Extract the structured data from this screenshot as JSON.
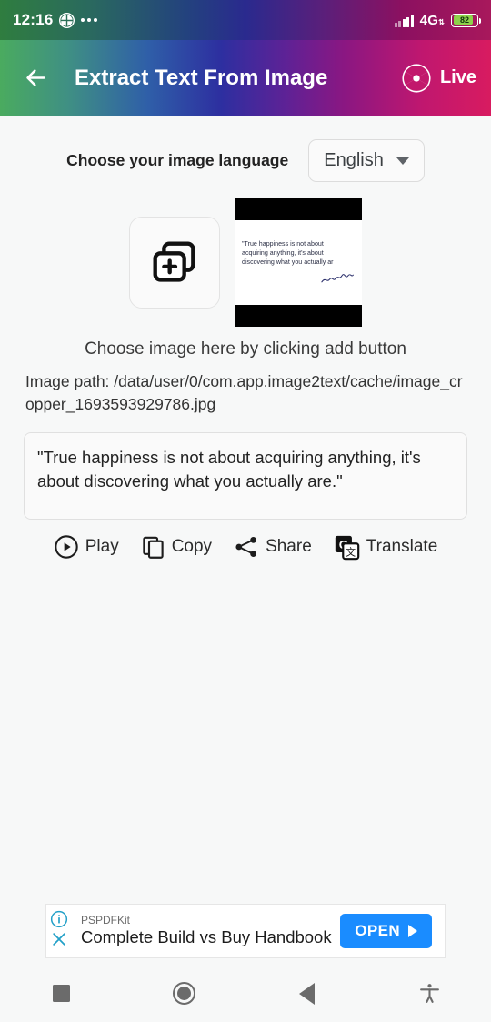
{
  "status_bar": {
    "time": "12:16",
    "network": "4G",
    "battery_level": "82",
    "battery_percent": 82,
    "icons": [
      "clover-icon",
      "more-dots-icon",
      "signal-icon",
      "network-4g-icon",
      "battery-icon"
    ]
  },
  "app_bar": {
    "title": "Extract Text From Image",
    "back_icon": "arrow-left-icon",
    "live_label": "Live",
    "live_icon": "camera-shutter-icon"
  },
  "language": {
    "label": "Choose your image language",
    "selected": "English",
    "caret_icon": "chevron-down-icon"
  },
  "picker": {
    "add_icon": "add-image-stack-icon",
    "hint": "Choose image here by clicking add button",
    "thumbnail": {
      "lines": [
        "\"True happiness is not about",
        "acquiring anything, it's about",
        "discovering what you actually ar"
      ],
      "signature_alt": "handwritten-signature"
    }
  },
  "image_path": {
    "text": "Image path: /data/user/0/com.app.image2text/cache/image_cropper_1693593929786.jpg"
  },
  "result": {
    "text": "\"True happiness is not about acquiring anything, it's about discovering what you actually are.\""
  },
  "actions": [
    {
      "label": "Play",
      "icon": "play-circle-icon"
    },
    {
      "label": "Copy",
      "icon": "copy-icon"
    },
    {
      "label": "Share",
      "icon": "share-icon"
    },
    {
      "label": "Translate",
      "icon": "google-translate-icon"
    }
  ],
  "ad": {
    "brand": "PSPDFKit",
    "title": "Complete Build vs Buy Handbook",
    "cta": "OPEN",
    "info_icon": "info-circle-icon",
    "close_icon": "close-x-icon",
    "cta_color": "#1a8cff"
  },
  "nav_bar": {
    "items": [
      {
        "name": "recents-button",
        "icon": "square-icon"
      },
      {
        "name": "home-button",
        "icon": "circle-icon"
      },
      {
        "name": "back-button",
        "icon": "triangle-left-icon"
      },
      {
        "name": "accessibility-button",
        "icon": "accessibility-icon"
      }
    ]
  },
  "theme": {
    "gradient_start": "#4aab5f",
    "gradient_mid": "#2d2fa0",
    "gradient_end": "#d81b60",
    "background": "#f7f8f8"
  }
}
